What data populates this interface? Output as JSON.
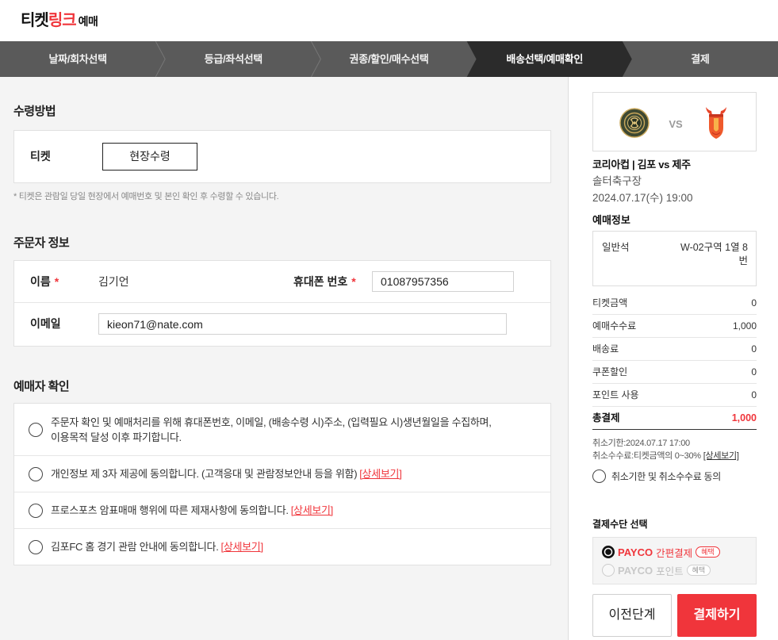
{
  "header": {
    "logo_ticket": "티켓",
    "logo_link": "링크",
    "logo_reserve": "예매"
  },
  "steps": [
    {
      "label": "날짜/회차선택",
      "active": false
    },
    {
      "label": "등급/좌석선택",
      "active": false
    },
    {
      "label": "권종/할인/매수선택",
      "active": false
    },
    {
      "label": "배송선택/예매확인",
      "active": true
    },
    {
      "label": "결제",
      "active": false
    }
  ],
  "receive": {
    "title": "수령방법",
    "ticket_label": "티켓",
    "method_button": "현장수령",
    "note": "* 티켓은 관람일 당일 현장에서 예매번호 및 본인 확인 후 수령할 수 있습니다."
  },
  "orderer": {
    "title": "주문자 정보",
    "required_mark": "*",
    "name_label": "이름",
    "name_value": "김기언",
    "phone_label": "휴대폰 번호",
    "phone_value": "01087957356",
    "email_label": "이메일",
    "email_value": "kieon71@nate.com"
  },
  "agreement": {
    "title": "예매자 확인",
    "items": [
      {
        "lines": [
          "주문자 확인 및 예매처리를 위해 휴대폰번호, 이메일, (배송수령 시)주소, (입력필요 시)생년월일을 수집하며,",
          "이용목적 달성 이후 파기합니다."
        ]
      },
      {
        "lines": [
          "개인정보 제 3자 제공에 동의합니다. (고객응대 및 관람정보안내 등을 위함)"
        ],
        "link": "[상세보기]"
      },
      {
        "lines": [
          "프로스포츠 암표매매 행위에 따른 제재사항에 동의합니다."
        ],
        "link": "[상세보기]"
      },
      {
        "lines": [
          "김포FC 홈 경기 관람 안내에 동의합니다."
        ],
        "link": "[상세보기]"
      }
    ]
  },
  "summary": {
    "match": {
      "home_logo_icon": "gimpo-fc-logo",
      "vs": "VS",
      "away_logo_icon": "jeju-united-logo"
    },
    "title": "코리아컵 | 김포 vs 제주",
    "venue": "솔터축구장",
    "datetime": "2024.07.17(수) 19:00",
    "booking_info_title": "예매정보",
    "seat_grade": "일반석",
    "seat_location": "W-02구역 1열 8번",
    "prices": [
      {
        "label": "티켓금액",
        "value": "0"
      },
      {
        "label": "예매수수료",
        "value": "1,000"
      },
      {
        "label": "배송료",
        "value": "0"
      },
      {
        "label": "쿠폰할인",
        "value": "0"
      },
      {
        "label": "포인트 사용",
        "value": "0"
      }
    ],
    "total": {
      "label": "총결제",
      "value": "1,000"
    },
    "cancel_deadline": "취소기한:2024.07.17 17:00",
    "cancel_fee": "취소수수료:티켓금액의 0~30%",
    "cancel_fee_link": "[상세보기]",
    "cancel_agree_label": "취소기한 및 취소수수료 동의"
  },
  "payment": {
    "title": "결제수단 선택",
    "options": [
      {
        "brand": "PAYCO",
        "name": "간편결제",
        "badge": "혜택",
        "selected": true,
        "enabled": true
      },
      {
        "brand": "PAYCO",
        "name": "포인트",
        "badge": "혜택",
        "selected": false,
        "enabled": false
      }
    ]
  },
  "actions": {
    "prev_label": "이전단계",
    "pay_label": "결제하기"
  },
  "colors": {
    "accent": "#f0353b",
    "step_bg": "#5a5a5a",
    "step_active": "#2b2b2b",
    "panel_bg": "#f4f4f4"
  }
}
